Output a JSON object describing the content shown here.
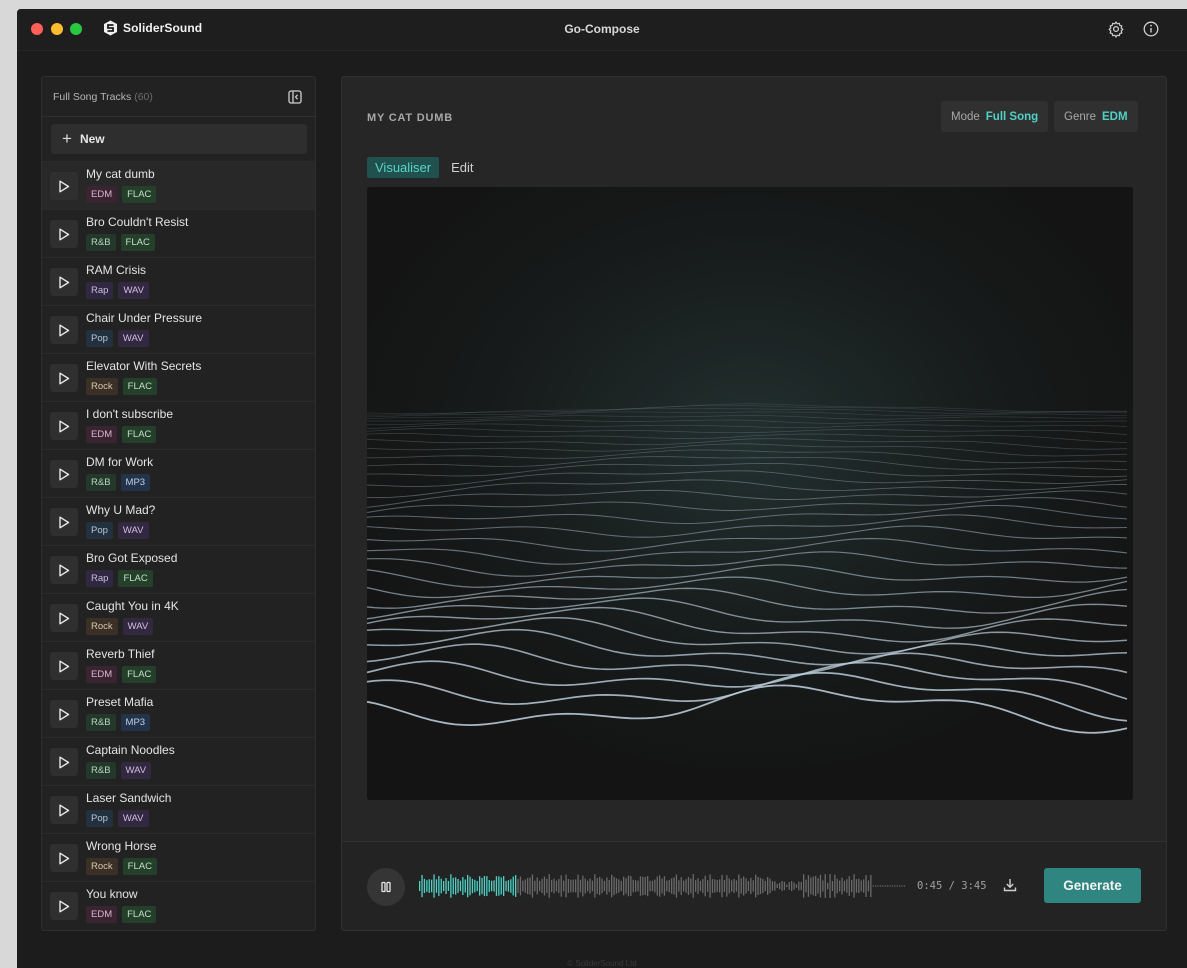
{
  "app": {
    "brand": "SoliderSound",
    "window_title": "Go-Compose",
    "footer": "© SoliderSound Ltd"
  },
  "sidebar": {
    "title": "Full Song Tracks",
    "count": "(60)",
    "new_label": "New",
    "tracks": [
      {
        "name": "My cat dumb",
        "genre": "EDM",
        "format": "FLAC"
      },
      {
        "name": "Bro Couldn't Resist",
        "genre": "R&B",
        "format": "FLAC"
      },
      {
        "name": "RAM Crisis",
        "genre": "Rap",
        "format": "WAV"
      },
      {
        "name": "Chair Under Pressure",
        "genre": "Pop",
        "format": "WAV"
      },
      {
        "name": "Elevator With Secrets",
        "genre": "Rock",
        "format": "FLAC"
      },
      {
        "name": "I don't subscribe",
        "genre": "EDM",
        "format": "FLAC"
      },
      {
        "name": "DM for Work",
        "genre": "R&B",
        "format": "MP3"
      },
      {
        "name": "Why U Mad?",
        "genre": "Pop",
        "format": "WAV"
      },
      {
        "name": "Bro Got Exposed",
        "genre": "Rap",
        "format": "FLAC"
      },
      {
        "name": "Caught You in 4K",
        "genre": "Rock",
        "format": "WAV"
      },
      {
        "name": "Reverb Thief",
        "genre": "EDM",
        "format": "FLAC"
      },
      {
        "name": "Preset Mafia",
        "genre": "R&B",
        "format": "MP3"
      },
      {
        "name": "Captain Noodles",
        "genre": "R&B",
        "format": "WAV"
      },
      {
        "name": "Laser Sandwich",
        "genre": "Pop",
        "format": "WAV"
      },
      {
        "name": "Wrong Horse",
        "genre": "Rock",
        "format": "FLAC"
      },
      {
        "name": "You know",
        "genre": "EDM",
        "format": "FLAC"
      }
    ],
    "active_index": 0
  },
  "tag_colors": {
    "EDM": {
      "bg": "#3a2432",
      "fg": "#d9b7c9"
    },
    "R&B": {
      "bg": "#23372a",
      "fg": "#b9d8c0"
    },
    "Rap": {
      "bg": "#2f2840",
      "fg": "#c6bde0"
    },
    "Pop": {
      "bg": "#23303e",
      "fg": "#b8c8dc"
    },
    "Rock": {
      "bg": "#3a3025",
      "fg": "#d8c6ad"
    },
    "FLAC": {
      "bg": "#24402b",
      "fg": "#bfe0c4"
    },
    "WAV": {
      "bg": "#322840",
      "fg": "#cdbfe2"
    },
    "MP3": {
      "bg": "#23344a",
      "fg": "#bcd0ea"
    }
  },
  "main": {
    "song_title": "MY CAT DUMB",
    "mode_label": "Mode",
    "mode_value": "Full Song",
    "genre_label": "Genre",
    "genre_value": "EDM",
    "tabs": [
      {
        "label": "Visualiser",
        "active": true
      },
      {
        "label": "Edit",
        "active": false
      }
    ]
  },
  "player": {
    "time": "0:45 / 3:45",
    "progress": 0.2,
    "generate_label": "Generate"
  },
  "colors": {
    "accent": "#4fd1c5",
    "button": "#2f8580"
  },
  "icons": {
    "brand": "brand-logo-icon",
    "settings": "gear-icon",
    "info": "info-icon",
    "collapse": "sidebar-collapse-icon",
    "play": "play-icon",
    "pause": "pause-icon",
    "download": "download-icon"
  }
}
